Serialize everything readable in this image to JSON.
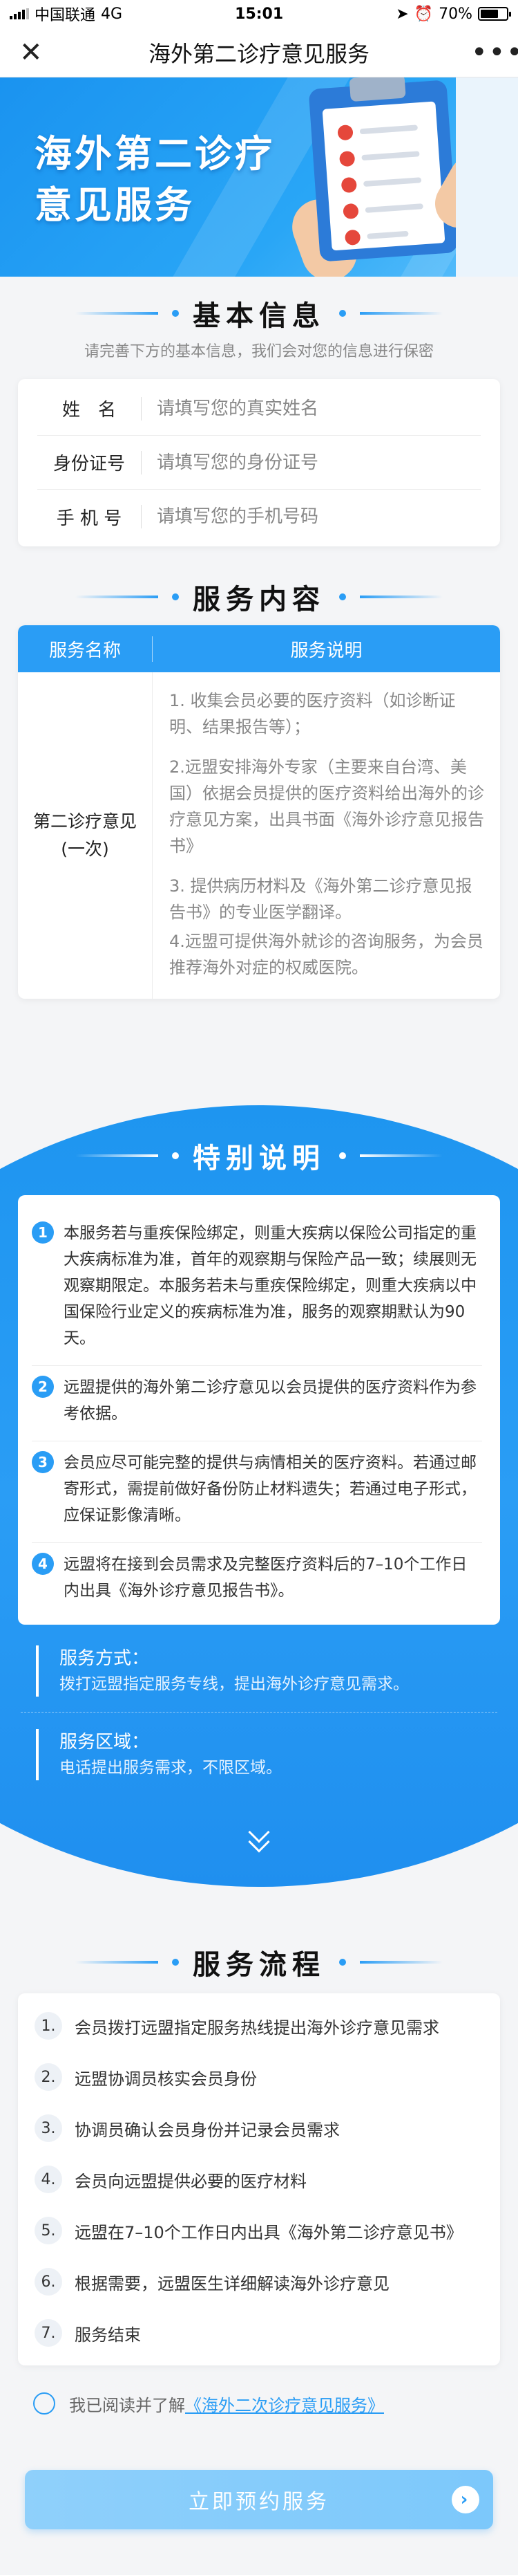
{
  "status_bar": {
    "carrier": "中国联通",
    "network": "4G",
    "time": "15:01",
    "battery": "70%",
    "battery_level": 0.7
  },
  "nav": {
    "close_icon": "close-icon",
    "title": "海外第二诊疗意见服务",
    "more_icon": "more-icon"
  },
  "banner": {
    "line1": "海外第二诊疗",
    "line2": "意见服务"
  },
  "basic_info": {
    "title": "基本信息",
    "subtitle": "请完善下方的基本信息，我们会对您的信息进行保密",
    "fields": [
      {
        "label": "姓　名",
        "placeholder": "请填写您的真实姓名",
        "value": ""
      },
      {
        "label": "身份证号",
        "placeholder": "请填写您的身份证号",
        "value": ""
      },
      {
        "label": "手 机 号",
        "placeholder": "请填写您的手机号码",
        "value": ""
      }
    ]
  },
  "service_content": {
    "title": "服务内容",
    "col_name": "服务名称",
    "col_desc": "服务说明",
    "row_name_line1": "第二诊疗意见",
    "row_name_line2": "(一次)",
    "desc": [
      "1. 收集会员必要的医疗资料（如诊断证明、结果报告等）；",
      "2.远盟安排海外专家（主要来自台湾、美国）依据会员提供的医疗资料给出海外的诊疗意见方案，出具书面《海外诊疗意见报告书》",
      "3. 提供病历材料及《海外第二诊疗意见报告书》的专业医学翻译。",
      "4.远盟可提供海外就诊的咨询服务，为会员推荐海外对症的权威医院。"
    ]
  },
  "special_notes": {
    "title": "特别说明",
    "items": [
      {
        "num": "1",
        "text": "本服务若与重疾保险绑定，则重大疾病以保险公司指定的重大疾病标准为准，首年的观察期与保险产品一致；续展则无观察期限定。本服务若未与重疾保险绑定，则重大疾病以中国保险行业定义的疾病标准为准，服务的观察期默认为90天。"
      },
      {
        "num": "2",
        "text": "远盟提供的海外第二诊疗意见以会员提供的医疗资料作为参考依据。"
      },
      {
        "num": "3",
        "text": "会员应尽可能完整的提供与病情相关的医疗资料。若通过邮寄形式，需提前做好备份防止材料遗失；若通过电子形式，应保证影像清晰。"
      },
      {
        "num": "4",
        "text": "远盟将在接到会员需求及完整医疗资料后的7–10个工作日内出具《海外诊疗意见报告书》。"
      }
    ],
    "method_title": "服务方式：",
    "method_desc": "拨打远盟指定服务专线，提出海外诊疗意见需求。",
    "area_title": "服务区域：",
    "area_desc": "电话提出服务需求，不限区域。",
    "expand_icon": "double-chevron-down-icon"
  },
  "service_flow": {
    "title": "服务流程",
    "steps": [
      {
        "num": "1.",
        "text": "会员拨打远盟指定服务热线提出海外诊疗意见需求"
      },
      {
        "num": "2.",
        "text": "远盟协调员核实会员身份"
      },
      {
        "num": "3.",
        "text": "协调员确认会员身份并记录会员需求"
      },
      {
        "num": "4.",
        "text": "会员向远盟提供必要的医疗材料"
      },
      {
        "num": "5.",
        "text": "远盟在7–10个工作日内出具《海外第二诊疗意见书》"
      },
      {
        "num": "6.",
        "text": "根据需要，远盟医生详细解读海外诊疗意见"
      },
      {
        "num": "7.",
        "text": "服务结束"
      }
    ]
  },
  "agreement": {
    "prefix": "我已阅读并了解",
    "link": "《海外二次诊疗意见服务》"
  },
  "submit": {
    "label": "立即预约服务",
    "icon": "chevron-right-icon"
  },
  "colors": {
    "primary": "#2a9df5",
    "button": "#8fd0fb",
    "background": "#f4f5f7"
  }
}
